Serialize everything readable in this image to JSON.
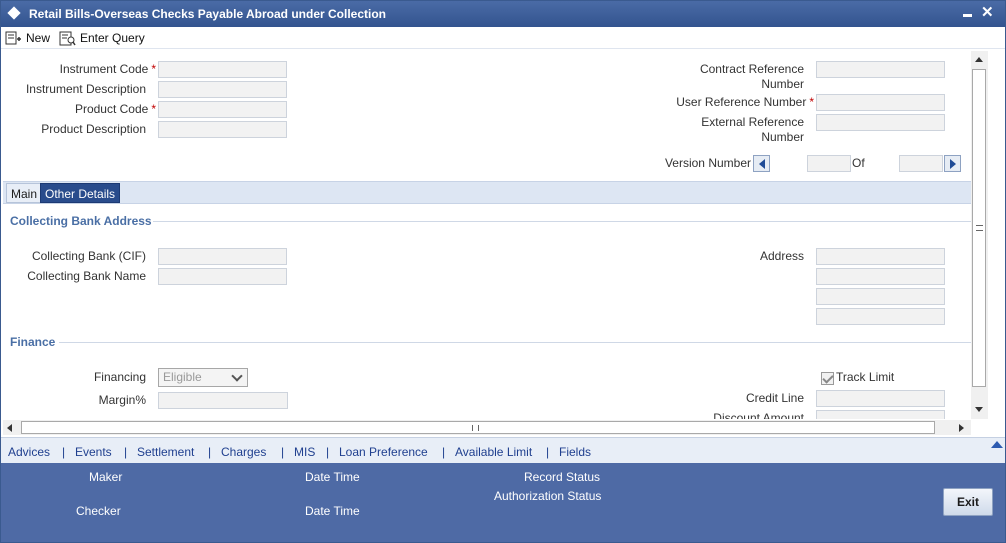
{
  "window": {
    "title": "Retail Bills-Overseas Checks Payable Abroad under Collection"
  },
  "toolbar": {
    "new_label": "New",
    "enter_query_label": "Enter Query"
  },
  "header_fields": {
    "instrument_code": "Instrument Code",
    "instrument_description": "Instrument Description",
    "product_code": "Product Code",
    "product_description": "Product Description",
    "contract_reference_line1": "Contract Reference",
    "contract_reference_line2": "Number",
    "user_reference_number": "User Reference Number",
    "external_reference_line1": "External Reference",
    "external_reference_line2": "Number",
    "version_number": "Version Number",
    "of": "Of",
    "required_marker": "*"
  },
  "tabs": {
    "main": "Main",
    "other_details": "Other Details"
  },
  "collecting_bank": {
    "section_title": "Collecting Bank Address",
    "cif_label": "Collecting Bank (CIF)",
    "name_label": "Collecting Bank Name",
    "address_label": "Address"
  },
  "finance": {
    "section_title": "Finance",
    "financing_label": "Financing",
    "financing_value": "Eligible",
    "margin_label": "Margin%",
    "track_limit_label": "Track Limit",
    "track_limit_checked": true,
    "credit_line_label": "Credit Line",
    "discount_amount_label": "Discount Amount"
  },
  "links": [
    "Advices",
    "Events",
    "Settlement",
    "Charges",
    "MIS",
    "Loan Preference",
    "Available Limit",
    "Fields"
  ],
  "link_separator": "|",
  "audit": {
    "maker": "Maker",
    "checker": "Checker",
    "date_time_1": "Date Time",
    "date_time_2": "Date Time",
    "record_status": "Record Status",
    "authorization_status": "Authorization Status",
    "exit_label": "Exit"
  }
}
